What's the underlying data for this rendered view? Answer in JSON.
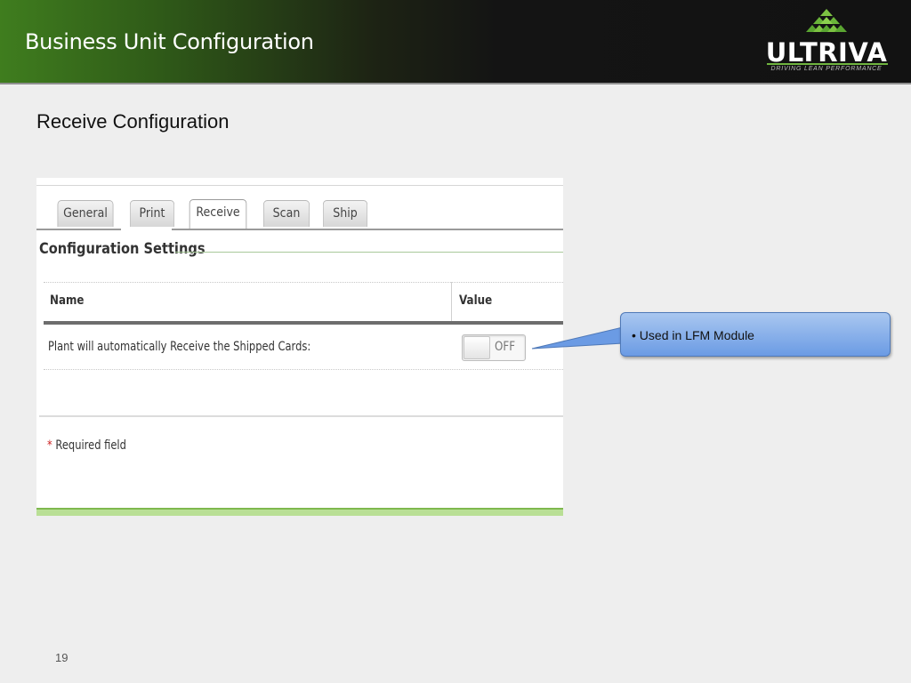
{
  "header": {
    "title": "Business Unit Configuration",
    "logo_text": "ULTRIVA",
    "logo_tagline": "DRIVING LEAN PERFORMANCE"
  },
  "section_title": "Receive Configuration",
  "panel": {
    "tabs": [
      {
        "label": "General",
        "active": false
      },
      {
        "label": "Print",
        "active": false
      },
      {
        "label": "Receive",
        "active": true
      },
      {
        "label": "Scan",
        "active": false
      },
      {
        "label": "Ship",
        "active": false
      }
    ],
    "config_title": "Configuration Settings",
    "table": {
      "headers": {
        "name": "Name",
        "value": "Value"
      },
      "rows": [
        {
          "label": "Plant will automatically Receive the Shipped Cards:",
          "toggle": "OFF"
        }
      ]
    },
    "required_star": "*",
    "required_text": "Required field"
  },
  "callout": {
    "bullet": "•",
    "text": "Used in LFM Module"
  },
  "page_number": "19",
  "colors": {
    "brand_green": "#3f7d1e",
    "header_dark": "#141414",
    "callout_blue": "#6b9be4",
    "required_red": "#cc2222"
  }
}
